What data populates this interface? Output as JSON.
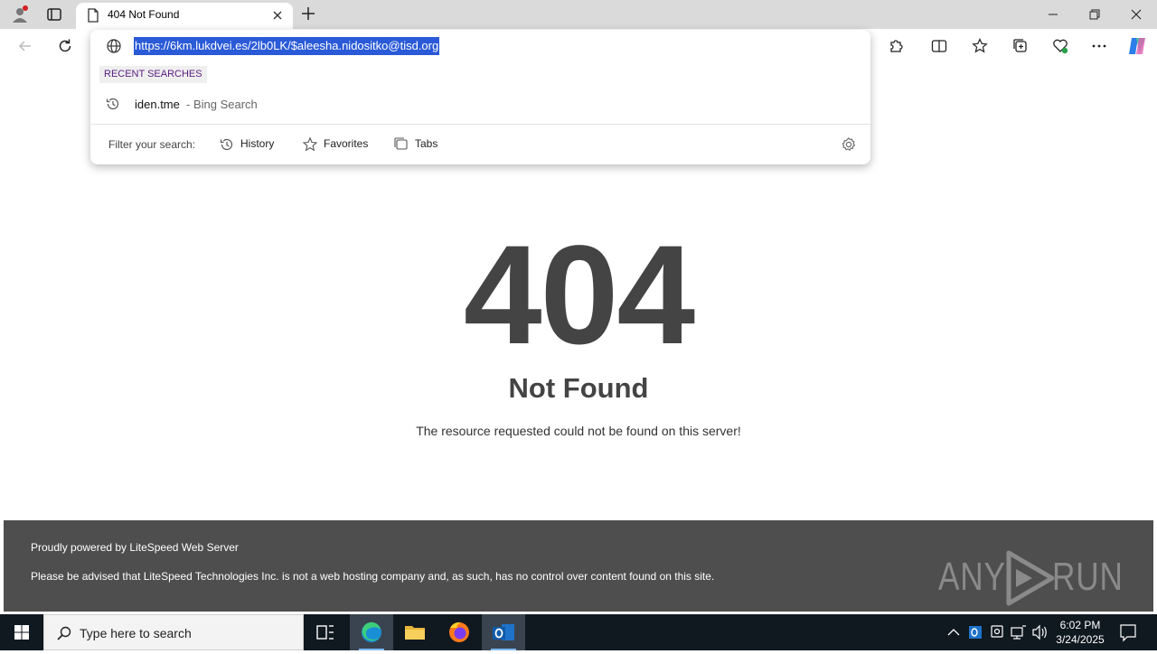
{
  "browser": {
    "tab": {
      "title": "404 Not Found"
    },
    "address": {
      "url": "https://6km.lukdvei.es/2lb0LK/$aleesha.nidositko@tisd.org"
    }
  },
  "omnibox": {
    "recent_label": "RECENT SEARCHES",
    "suggestion": {
      "query": "iden.tme",
      "source": "- Bing Search"
    },
    "filter_label": "Filter your search:",
    "filters": [
      {
        "label": "History",
        "icon": "history-icon"
      },
      {
        "label": "Favorites",
        "icon": "star-icon"
      },
      {
        "label": "Tabs",
        "icon": "tabs-icon"
      }
    ]
  },
  "page": {
    "code": "404",
    "heading": "Not Found",
    "message": "The resource requested could not be found on this server!",
    "footer_line1": "Proudly powered by LiteSpeed Web Server",
    "footer_line2": "Please be advised that LiteSpeed Technologies Inc. is not a web hosting company and, as such, has no control over content found on this site."
  },
  "watermark": {
    "left": "ANY",
    "right": "RUN"
  },
  "taskbar": {
    "search_placeholder": "Type here to search",
    "time": "6:02 PM",
    "date": "3/24/2025"
  },
  "colors": {
    "accent": "#2a5ad7",
    "heading": "#444444",
    "footer_bg": "#4e4e4e",
    "taskbar_bg": "#101820"
  }
}
